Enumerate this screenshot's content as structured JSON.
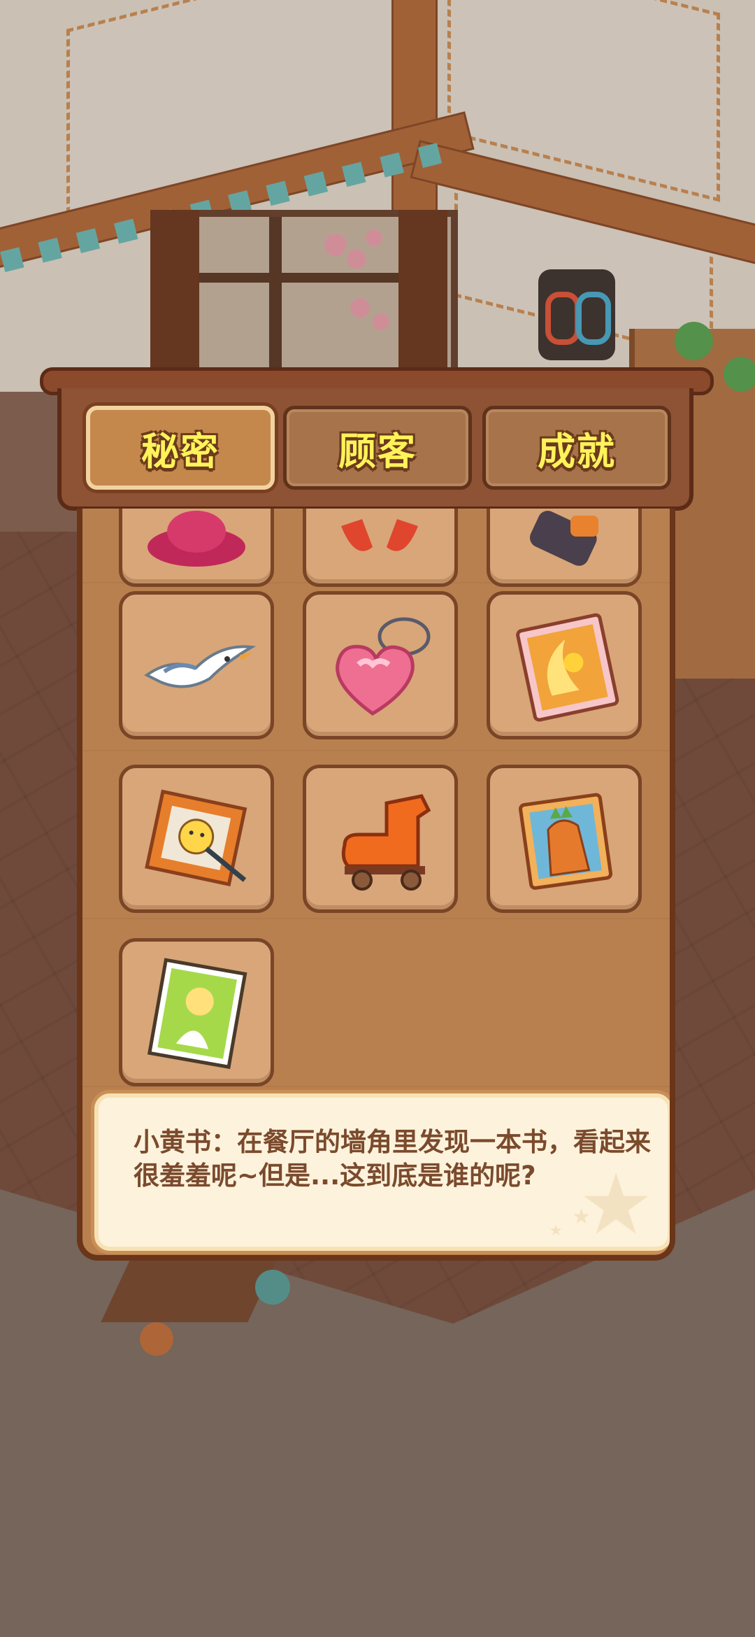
{
  "tabs": [
    {
      "label": "秘密",
      "active": true
    },
    {
      "label": "顾客",
      "active": false
    },
    {
      "label": "成就",
      "active": false
    }
  ],
  "items": [
    {
      "icon": "red-hat-icon"
    },
    {
      "icon": "red-ribbon-icon"
    },
    {
      "icon": "camera-icon"
    },
    {
      "icon": "seagull-icon"
    },
    {
      "icon": "heart-keychain-icon"
    },
    {
      "icon": "moon-duck-photo-icon"
    },
    {
      "icon": "duck-portrait-frame-icon"
    },
    {
      "icon": "roller-skate-icon"
    },
    {
      "icon": "carrot-photo-icon"
    },
    {
      "icon": "little-yellow-book-icon"
    }
  ],
  "description": {
    "text": "小黄书：在餐厅的墙角里发现一本书，看起来很羞羞呢~但是...这到底是谁的呢?"
  }
}
